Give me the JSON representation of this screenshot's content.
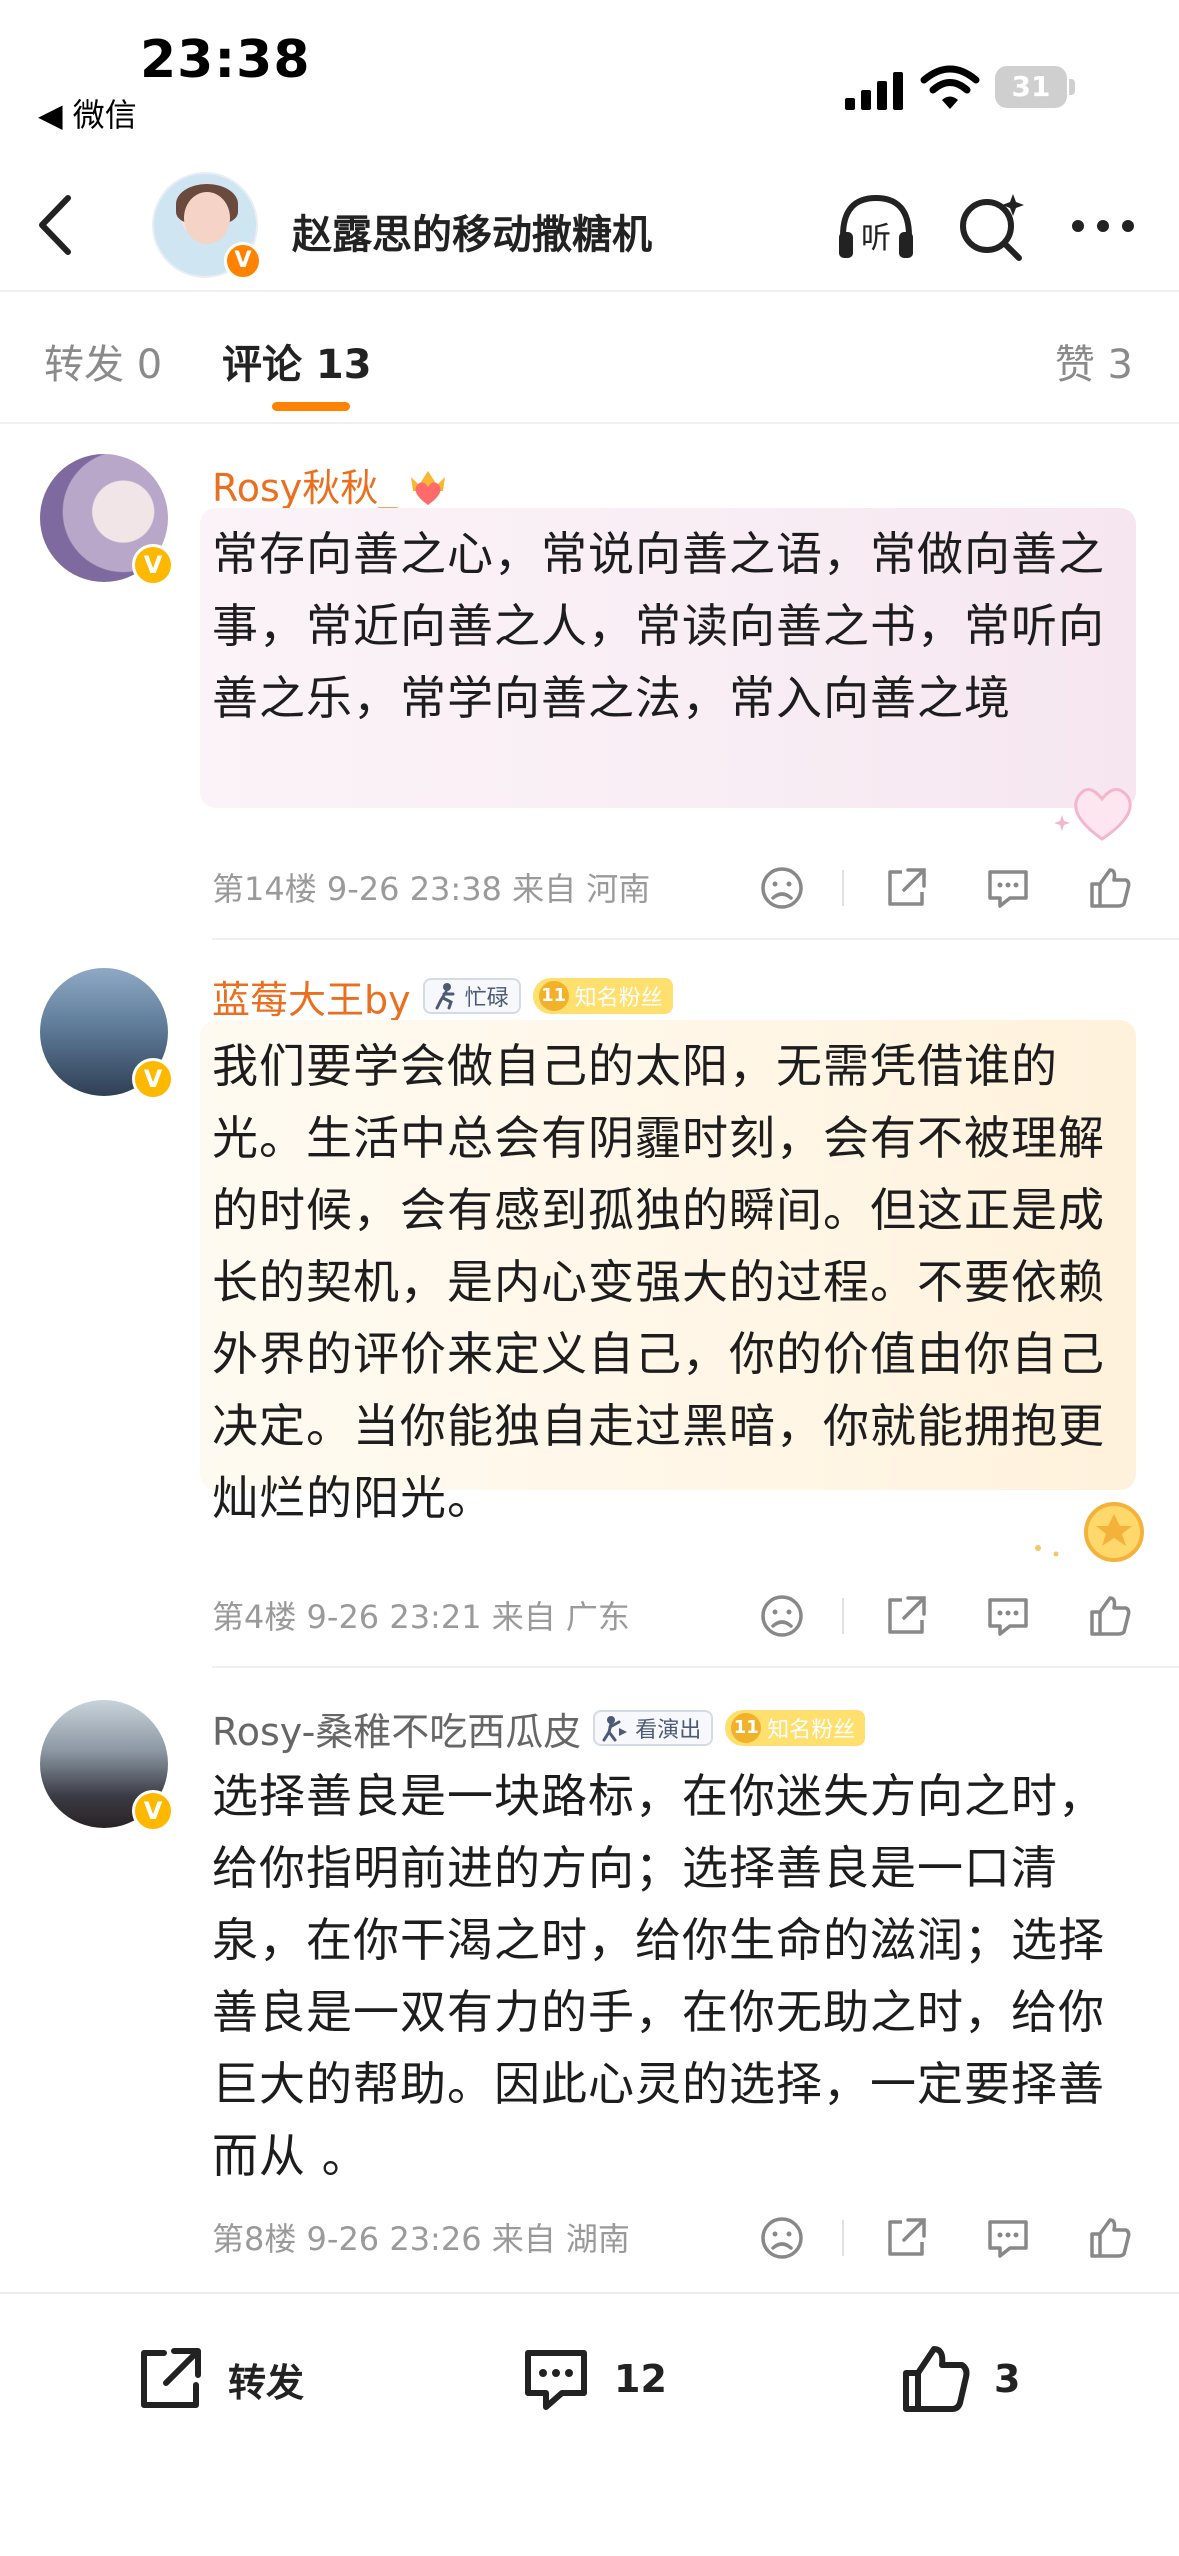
{
  "status_bar": {
    "time": "23:38",
    "back_app": "◀ 微信",
    "battery": "31",
    "battery_level": 0.31
  },
  "nav": {
    "title": "赵露思的移动撒糖机",
    "listen_label": "听"
  },
  "tabs": {
    "repost": "转发 0",
    "comment": "评论 13",
    "like": "赞 3"
  },
  "comments": [
    {
      "name": "Rosy秋秋_",
      "text": "常存向善之心，常说向善之语，常做向善之事，常近向善之人，常读向善之书，常听向善之乐，常学向善之法，常入向善之境",
      "meta": "第14楼 9-26 23:38 来自 河南",
      "verified_badge": "V"
    },
    {
      "name": "蓝莓大王by",
      "tag1": "忙碌",
      "tag2_level": "11",
      "tag2": "知名粉丝",
      "text": "我们要学会做自己的太阳，无需凭借谁的光。生活中总会有阴霾时刻，会有不被理解的时候，会有感到孤独的瞬间。但这正是成长的契机，是内心变强大的过程。不要依赖外界的评价来定义自己，你的价值由你自己决定。当你能独自走过黑暗，你就能拥抱更灿烂的阳光。",
      "meta": "第4楼 9-26 23:21 来自 广东",
      "verified_badge": "V"
    },
    {
      "name": "Rosy-桑稚不吃西瓜皮",
      "tag1": "看演出",
      "tag2_level": "11",
      "tag2": "知名粉丝",
      "text": "选择善良是一块路标，在你迷失方向之时，给你指明前进的方向；选择善良是一口清泉，在你干渴之时，给你生命的滋润；选择善良是一双有力的手，在你无助之时，给你巨大的帮助。因此心灵的选择，一定要择善而从 。",
      "meta": "第8楼 9-26 23:26 来自 湖南",
      "verified_badge": "V"
    }
  ],
  "bottom_bar": {
    "repost_label": "转发",
    "comment_count": "12",
    "like_count": "3"
  },
  "colors": {
    "accent": "#ff8200",
    "name_orange": "#ea6f1f",
    "meta_gray": "#9a9a9a"
  }
}
